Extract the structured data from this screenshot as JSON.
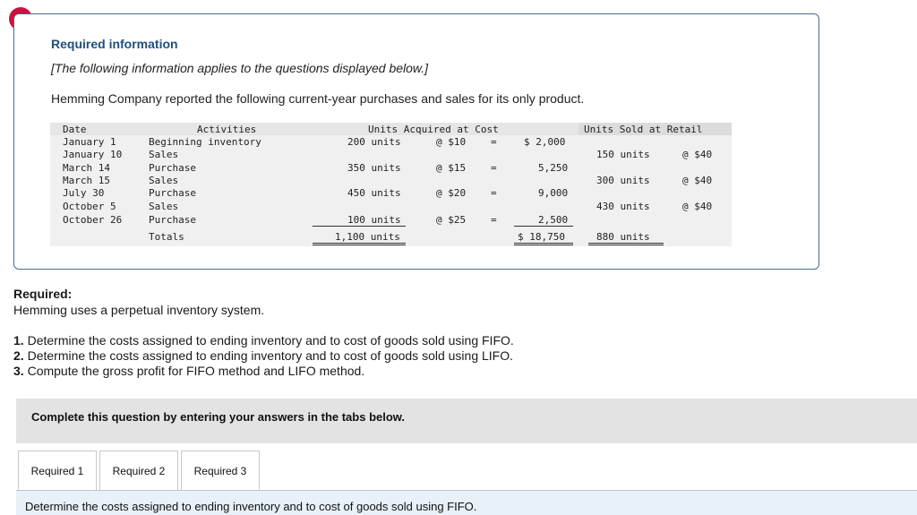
{
  "alert": {
    "glyph": "!"
  },
  "info": {
    "title": "Required information",
    "note": "[The following information applies to the questions displayed below.]",
    "intro": "Hemming Company reported the following current-year purchases and sales for its only product."
  },
  "table": {
    "headers": {
      "date": "Date",
      "activities": "Activities",
      "acquired": "Units Acquired at Cost",
      "sold": "Units Sold at Retail"
    },
    "rows": [
      {
        "date": "January 1",
        "activity": "Beginning inventory",
        "acq_units": "200 units",
        "acq_cost": "@ $10",
        "eq": "=",
        "acq_total": "$ 2,000",
        "sold_units": "",
        "sold_price": ""
      },
      {
        "date": "January 10",
        "activity": "Sales",
        "acq_units": "",
        "acq_cost": "",
        "eq": "",
        "acq_total": "",
        "sold_units": "150 units",
        "sold_price": "@ $40"
      },
      {
        "date": "March 14",
        "activity": "Purchase",
        "acq_units": "350 units",
        "acq_cost": "@ $15",
        "eq": "=",
        "acq_total": "5,250",
        "sold_units": "",
        "sold_price": ""
      },
      {
        "date": "March 15",
        "activity": "Sales",
        "acq_units": "",
        "acq_cost": "",
        "eq": "",
        "acq_total": "",
        "sold_units": "300 units",
        "sold_price": "@ $40"
      },
      {
        "date": "July 30",
        "activity": "Purchase",
        "acq_units": "450 units",
        "acq_cost": "@ $20",
        "eq": "=",
        "acq_total": "9,000",
        "sold_units": "",
        "sold_price": ""
      },
      {
        "date": "October 5",
        "activity": "Sales",
        "acq_units": "",
        "acq_cost": "",
        "eq": "",
        "acq_total": "",
        "sold_units": "430 units",
        "sold_price": "@ $40"
      },
      {
        "date": "October 26",
        "activity": "Purchase",
        "acq_units": "100 units",
        "acq_cost": "@ $25",
        "eq": "=",
        "acq_total": "2,500",
        "sold_units": "",
        "sold_price": ""
      }
    ],
    "totals": {
      "label": "Totals",
      "acq_units": "1,100 units",
      "acq_total": "$ 18,750",
      "sold_units": "880 units"
    }
  },
  "required": {
    "heading": "Required:",
    "text": "Hemming uses a perpetual inventory system.",
    "steps": [
      {
        "num": "1.",
        "text": "Determine the costs assigned to ending inventory and to cost of goods sold using FIFO."
      },
      {
        "num": "2.",
        "text": "Determine the costs assigned to ending inventory and to cost of goods sold using LIFO."
      },
      {
        "num": "3.",
        "text": "Compute the gross profit for FIFO method and LIFO method."
      }
    ]
  },
  "complete": {
    "text": "Complete this question by entering your answers in the tabs below."
  },
  "tabs": [
    {
      "label": "Required 1"
    },
    {
      "label": "Required 2"
    },
    {
      "label": "Required 3"
    }
  ],
  "panel": {
    "text": "Determine the costs assigned to ending inventory and to cost of goods sold using FIFO."
  }
}
